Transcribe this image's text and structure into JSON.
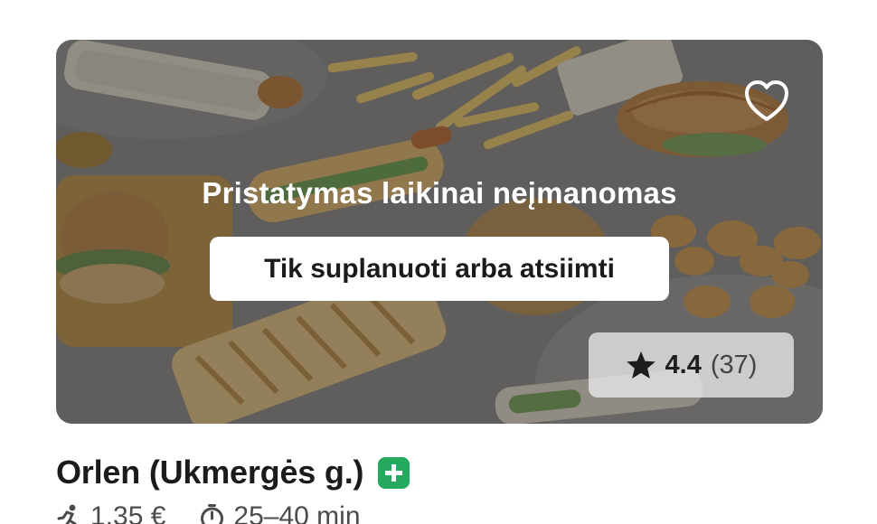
{
  "restaurant": {
    "unavailable_message": "Pristatymas laikinai neįmanomas",
    "schedule_pickup_label": "Tik suplanuoti arba atsiimti",
    "rating_value": "4.4",
    "rating_count": "(37)",
    "name": "Orlen (Ukmergės g.)",
    "delivery_fee": "1,35 €",
    "delivery_time": "25–40 min",
    "favorite_icon": "heart-outline-icon",
    "rating_icon": "star-icon",
    "plus_icon": "plus-badge-icon",
    "courier_icon": "courier-icon",
    "timer_icon": "timer-icon"
  },
  "colors": {
    "accent": "#24a95f",
    "overlay": "#141414",
    "badge_bg": "#e9e9e9",
    "text": "#1b1b1b",
    "muted": "#4b4b4b"
  }
}
